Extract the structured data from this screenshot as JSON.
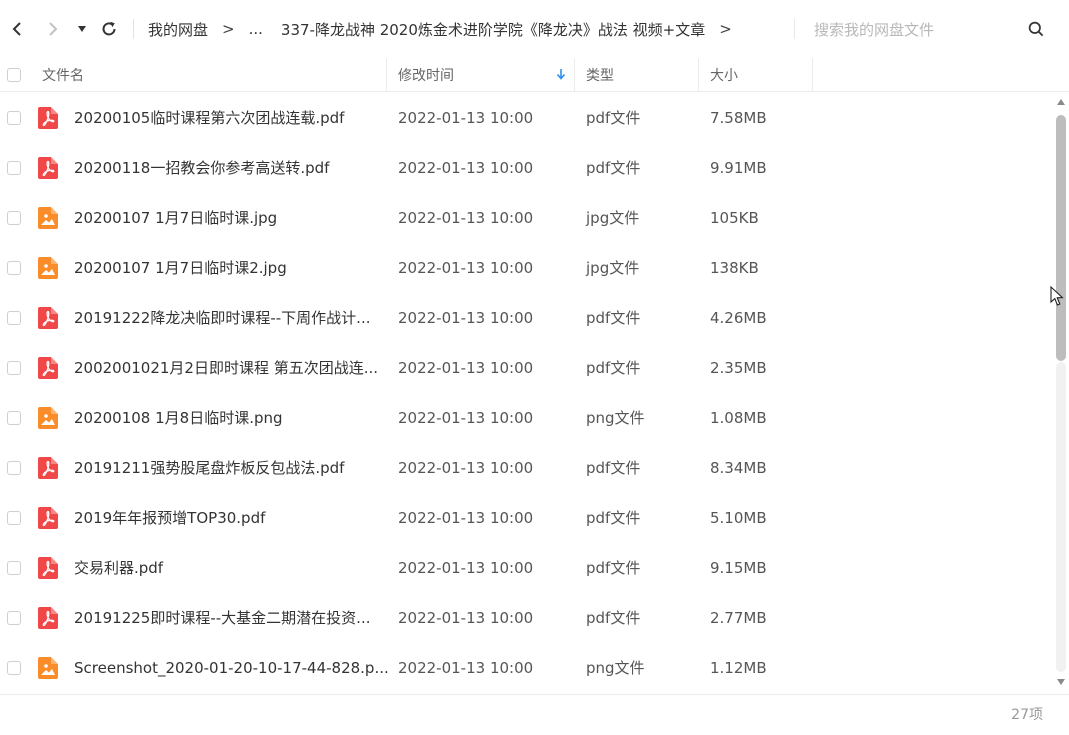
{
  "nav": {
    "breadcrumb": [
      "我的网盘",
      "...",
      "337-降龙战神 2020炼金术进阶学院《降龙决》战法 视频+文章"
    ],
    "search_placeholder": "搜索我的网盘文件"
  },
  "columns": {
    "name": "文件名",
    "modified": "修改时间",
    "type": "类型",
    "size": "大小"
  },
  "colors": {
    "pdf_icon": "#f04848",
    "image_icon": "#fb8c2a",
    "sort_arrow": "#2a8ff0"
  },
  "files": [
    {
      "name": "20200105临时课程第六次团战连载.pdf",
      "modified": "2022-01-13 10:00",
      "type": "pdf文件",
      "size": "7.58MB",
      "icon": "pdf-icon"
    },
    {
      "name": "20200118一招教会你参考高送转.pdf",
      "modified": "2022-01-13 10:00",
      "type": "pdf文件",
      "size": "9.91MB",
      "icon": "pdf-icon"
    },
    {
      "name": "20200107  1月7日临时课.jpg",
      "modified": "2022-01-13 10:00",
      "type": "jpg文件",
      "size": "105KB",
      "icon": "image-icon"
    },
    {
      "name": "20200107  1月7日临时课2.jpg",
      "modified": "2022-01-13 10:00",
      "type": "jpg文件",
      "size": "138KB",
      "icon": "image-icon"
    },
    {
      "name": "20191222降龙决临即时课程--下周作战计...",
      "modified": "2022-01-13 10:00",
      "type": "pdf文件",
      "size": "4.26MB",
      "icon": "pdf-icon"
    },
    {
      "name": "2002001021月2日即时课程 第五次团战连...",
      "modified": "2022-01-13 10:00",
      "type": "pdf文件",
      "size": "2.35MB",
      "icon": "pdf-icon"
    },
    {
      "name": "20200108  1月8日临时课.png",
      "modified": "2022-01-13 10:00",
      "type": "png文件",
      "size": "1.08MB",
      "icon": "image-icon"
    },
    {
      "name": "20191211强势股尾盘炸板反包战法.pdf",
      "modified": "2022-01-13 10:00",
      "type": "pdf文件",
      "size": "8.34MB",
      "icon": "pdf-icon"
    },
    {
      "name": "2019年年报预增TOP30.pdf",
      "modified": "2022-01-13 10:00",
      "type": "pdf文件",
      "size": "5.10MB",
      "icon": "pdf-icon"
    },
    {
      "name": "交易利器.pdf",
      "modified": "2022-01-13 10:00",
      "type": "pdf文件",
      "size": "9.15MB",
      "icon": "pdf-icon"
    },
    {
      "name": "20191225即时课程--大基金二期潜在投资...",
      "modified": "2022-01-13 10:00",
      "type": "pdf文件",
      "size": "2.77MB",
      "icon": "pdf-icon"
    },
    {
      "name": "Screenshot_2020-01-20-10-17-44-828.p...",
      "modified": "2022-01-13 10:00",
      "type": "png文件",
      "size": "1.12MB",
      "icon": "image-icon"
    }
  ],
  "footer": {
    "item_count": "27项"
  }
}
